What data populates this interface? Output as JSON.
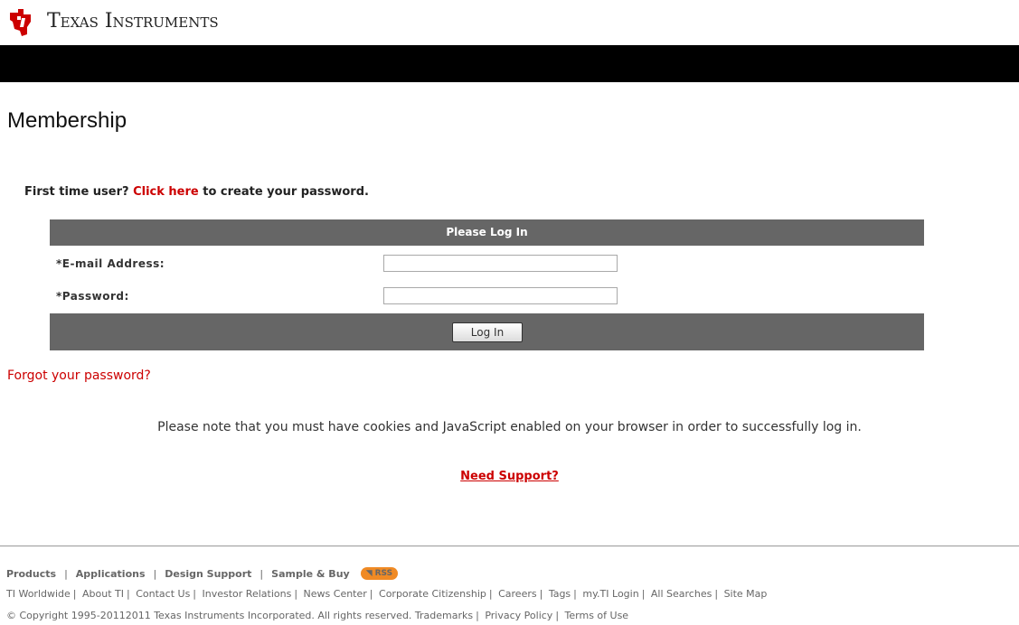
{
  "header": {
    "brand": "Texas Instruments"
  },
  "page": {
    "title": "Membership"
  },
  "intro": {
    "prefix": "First time user?",
    "link": "Click here",
    "suffix": "to create your password."
  },
  "login": {
    "heading": "Please Log In",
    "email_label": "*E-mail Address:",
    "email_value": "",
    "password_label": "*Password:",
    "password_value": "",
    "button": "Log In"
  },
  "forgot": "Forgot your password?",
  "notice": "Please note that you must have cookies and JavaScript enabled on your browser in order to successfully log in.",
  "support": "Need Support?",
  "footer": {
    "primary": [
      "Products",
      "Applications",
      "Design Support",
      "Sample & Buy"
    ],
    "separator": "|",
    "rss": "RSS",
    "secondary": [
      "TI Worldwide",
      "About TI",
      "Contact Us",
      "Investor Relations",
      "News Center",
      "Corporate Citizenship",
      "Careers",
      "Tags",
      "my.TI Login",
      "All Searches",
      "Site Map"
    ],
    "copyright": "© Copyright 1995-20112011 Texas Instruments Incorporated. All rights reserved.",
    "legal": [
      "Trademarks",
      "Privacy Policy",
      "Terms of Use"
    ]
  },
  "colors": {
    "brand_red": "#cc0000",
    "nav_bar": "#000000",
    "panel": "#666666",
    "rss": "#f08a24"
  }
}
